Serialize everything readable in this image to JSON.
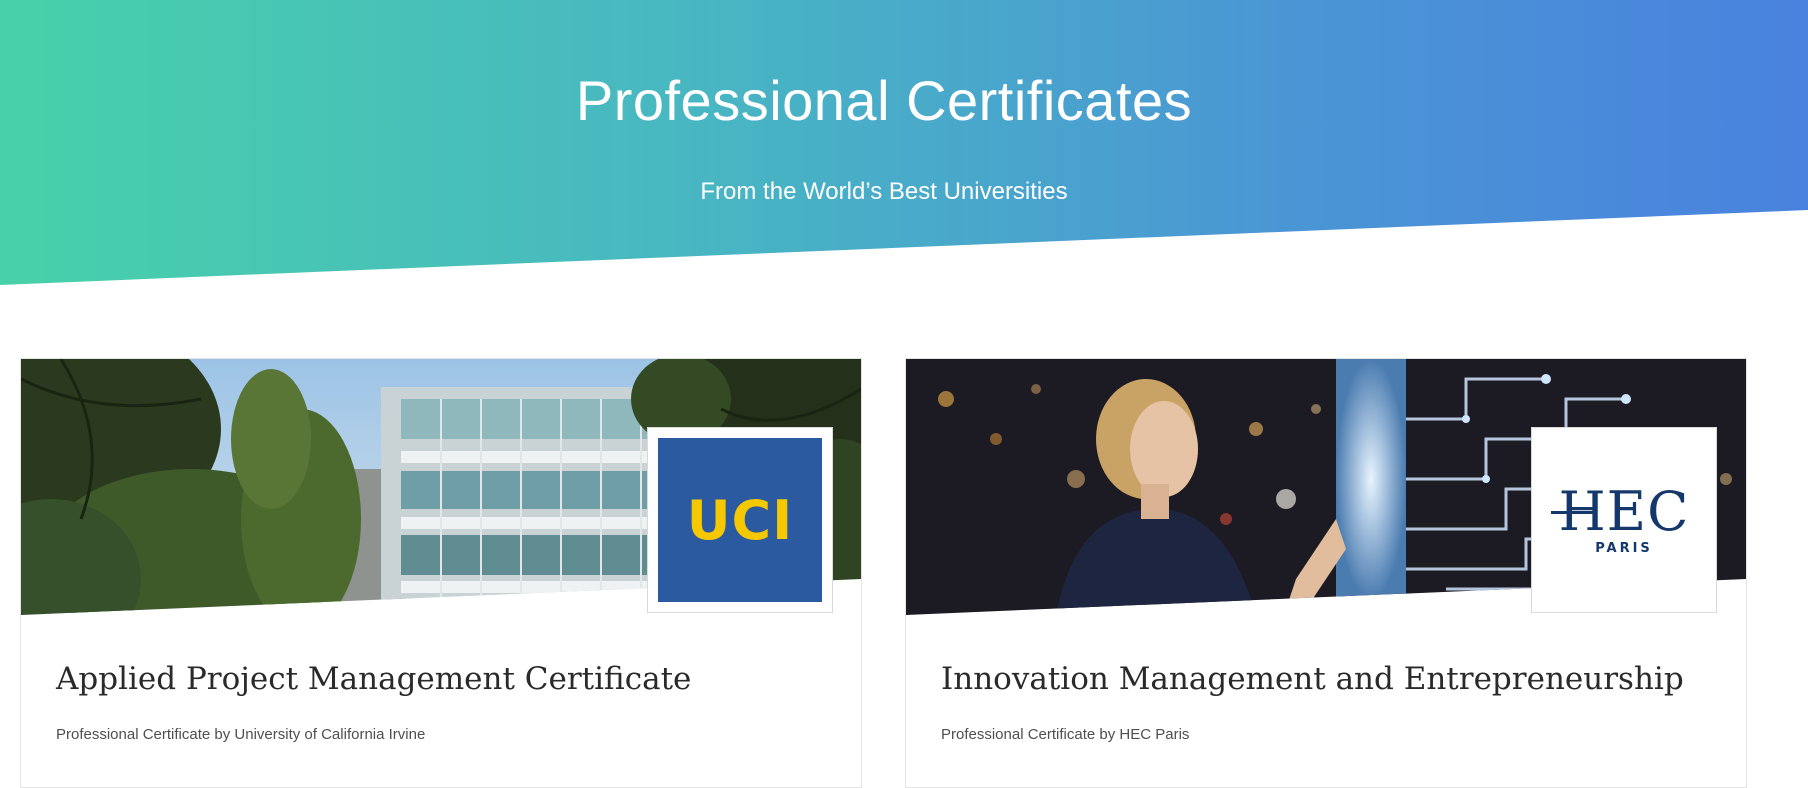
{
  "hero": {
    "title": "Professional Certificates",
    "subtitle": "From the World’s Best Universities",
    "gradient_start": "#47d1a9",
    "gradient_end": "#4982de"
  },
  "cards": [
    {
      "title": "Applied Project Management Certificate",
      "description": "Professional Certificate by University of California Irvine",
      "logo_text": "UCI",
      "logo_bg": "#2c5aa0",
      "logo_fg": "#f5c800",
      "image_subject": "campus-building-photo"
    },
    {
      "title": "Innovation Management and Entrepreneurship",
      "description": "Professional Certificate by HEC Paris",
      "logo_text": "HEC",
      "logo_subtext": "PARIS",
      "logo_fg": "#14386b",
      "image_subject": "woman-touching-digital-screen-photo"
    }
  ]
}
